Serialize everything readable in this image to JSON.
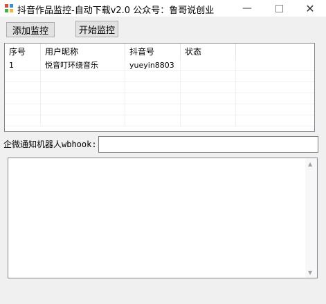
{
  "window": {
    "title": "抖音作品监控-自动下载v2.0 公众号：鲁哥说创业",
    "minimize_icon": "minimize-icon",
    "maximize_icon": "maximize-icon",
    "close_icon": "close-icon"
  },
  "toolbar": {
    "add_monitor_label": "添加监控",
    "start_monitor_label": "开始监控"
  },
  "table": {
    "headers": [
      "序号",
      "用户昵称",
      "抖音号",
      "状态",
      ""
    ],
    "rows": [
      [
        "1",
        "悦音叮环绕音乐",
        "yueyin8803",
        "",
        ""
      ]
    ]
  },
  "webhook": {
    "label": "企微通知机器人wbhook:",
    "value": ""
  },
  "log": {
    "value": ""
  },
  "colors": {
    "window_bg": "#f0f0f0",
    "button_bg": "#e1e1e1",
    "border": "#828790"
  }
}
